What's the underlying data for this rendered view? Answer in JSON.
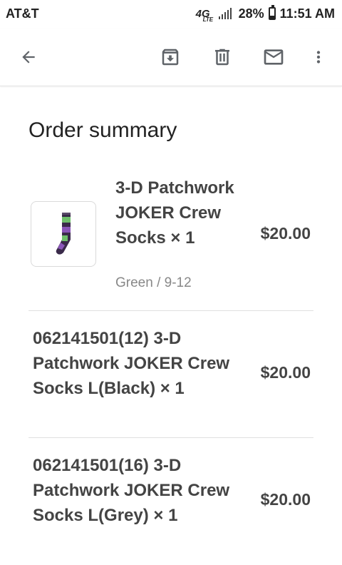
{
  "status_bar": {
    "carrier": "AT&T",
    "network": "4G",
    "network_sub": "LTE",
    "battery": "28%",
    "time": "11:51 AM"
  },
  "toolbar": {
    "icons": [
      "back-arrow-icon",
      "archive-icon",
      "delete-icon",
      "mail-icon",
      "more-vert-icon"
    ]
  },
  "order": {
    "title": "Order summary",
    "items": [
      {
        "name": "3-D Patchwork JOKER Crew Socks × 1",
        "variant": "Green / 9-12",
        "price": "$20.00"
      },
      {
        "name": "062141501(12) 3-D Patchwork JOKER Crew Socks L(Black) × 1",
        "price": "$20.00"
      },
      {
        "name": "062141501(16) 3-D Patchwork JOKER Crew Socks L(Grey) × 1",
        "price": "$20.00"
      }
    ]
  },
  "colors": {
    "text_dark": "#222222",
    "text_product": "#444444",
    "text_muted": "#888888",
    "divider": "#e0e0e0"
  }
}
